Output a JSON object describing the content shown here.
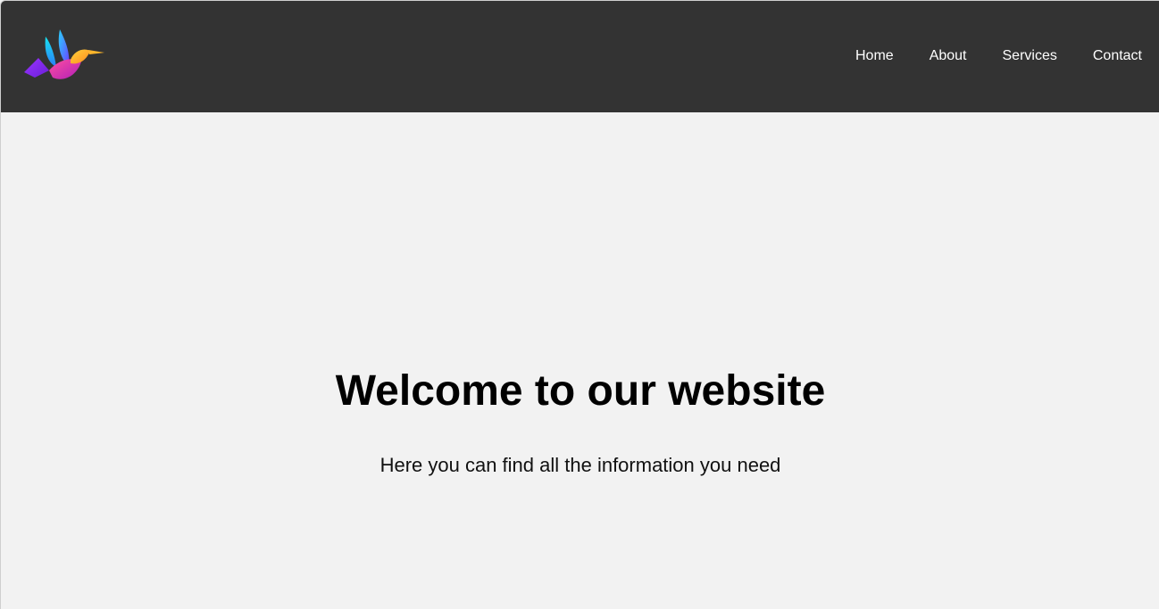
{
  "header": {
    "logo_icon": "hummingbird-logo-icon",
    "background_color": "#333333",
    "nav": [
      {
        "label": "Home"
      },
      {
        "label": "About"
      },
      {
        "label": "Services"
      },
      {
        "label": "Contact"
      }
    ]
  },
  "hero": {
    "title": "Welcome to our website",
    "subtitle": "Here you can find all the information you need",
    "background_color": "#f2f2f2"
  }
}
